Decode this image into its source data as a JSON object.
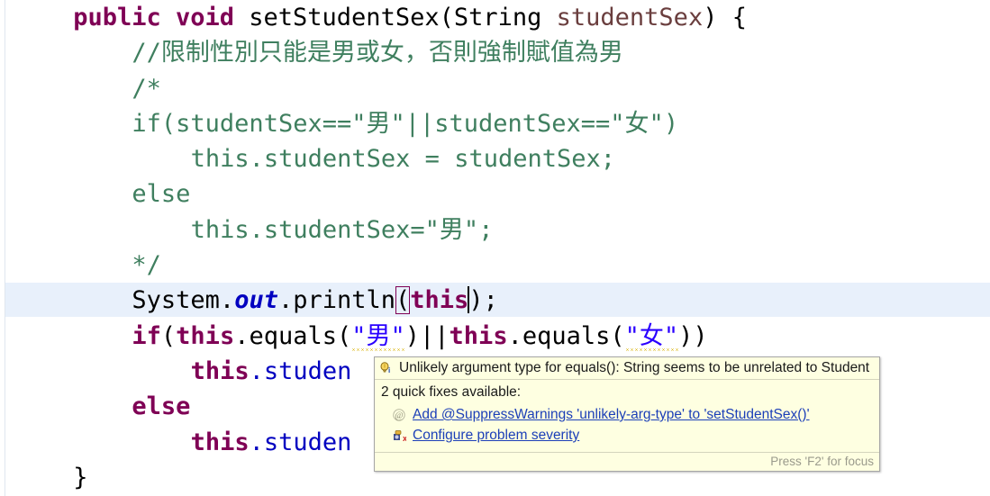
{
  "editor": {
    "language": "java",
    "current_line_index": 6,
    "colors": {
      "keyword": "#7f0055",
      "comment": "#3f7f5f",
      "string": "#2a00ff",
      "field": "#0000c0",
      "parameter": "#6a3e3e",
      "plain": "#000000",
      "line_highlight": "#e8f0fb",
      "bracket_match_outline": "#7f0055",
      "warning_squiggle": "#d8b000"
    },
    "lines": [
      {
        "indent": 4,
        "tokens": [
          {
            "text": "public void ",
            "style": "kw"
          },
          {
            "text": "setStudentSex(String ",
            "style": "plain"
          },
          {
            "text": "studentSex",
            "style": "param"
          },
          {
            "text": ") {",
            "style": "plain"
          }
        ]
      },
      {
        "indent": 8,
        "tokens": [
          {
            "text": "//限制性別只能是男或女，否則強制賦值為男",
            "style": "cmt"
          }
        ]
      },
      {
        "indent": 8,
        "tokens": [
          {
            "text": "/*",
            "style": "cmt"
          }
        ]
      },
      {
        "indent": 8,
        "tokens": [
          {
            "text": "if(studentSex==\"男\"||studentSex==\"女\")",
            "style": "cmt"
          }
        ]
      },
      {
        "indent": 12,
        "tokens": [
          {
            "text": "this.studentSex = studentSex;",
            "style": "cmt"
          }
        ]
      },
      {
        "indent": 8,
        "tokens": [
          {
            "text": "else",
            "style": "cmt"
          }
        ]
      },
      {
        "indent": 12,
        "tokens": [
          {
            "text": "this.studentSex=\"男\";",
            "style": "cmt"
          }
        ]
      },
      {
        "indent": 8,
        "tokens": [
          {
            "text": "*/",
            "style": "cmt"
          }
        ]
      },
      {
        "indent": 8,
        "highlighted": true,
        "tokens": [
          {
            "text": "System.",
            "style": "plain"
          },
          {
            "text": "out",
            "style": "statfld"
          },
          {
            "text": ".println",
            "style": "plain"
          },
          {
            "text": "(",
            "style": "plain",
            "bracket_match": true
          },
          {
            "text": "this",
            "style": "kw"
          },
          {
            "text": "",
            "style": "caret"
          },
          {
            "text": ");",
            "style": "plain"
          }
        ]
      },
      {
        "indent": 8,
        "tokens": [
          {
            "text": "if",
            "style": "kw"
          },
          {
            "text": "(",
            "style": "plain"
          },
          {
            "text": "this",
            "style": "kw"
          },
          {
            "text": ".equals(",
            "style": "plain"
          },
          {
            "text": "\"男\"",
            "style": "str",
            "squiggle": true
          },
          {
            "text": ")||",
            "style": "plain"
          },
          {
            "text": "this",
            "style": "kw"
          },
          {
            "text": ".equals(",
            "style": "plain"
          },
          {
            "text": "\"女\"",
            "style": "str",
            "squiggle": true
          },
          {
            "text": "))",
            "style": "plain"
          }
        ]
      },
      {
        "indent": 12,
        "tokens": [
          {
            "text": "this",
            "style": "kw"
          },
          {
            "text": ".studen",
            "style": "field"
          }
        ]
      },
      {
        "indent": 8,
        "tokens": [
          {
            "text": "else",
            "style": "kw"
          }
        ]
      },
      {
        "indent": 12,
        "tokens": [
          {
            "text": "this",
            "style": "kw"
          },
          {
            "text": ".studen",
            "style": "field"
          }
        ]
      },
      {
        "indent": 4,
        "tokens": [
          {
            "text": "}",
            "style": "plain"
          }
        ]
      }
    ]
  },
  "tooltip": {
    "header_icon": "lightbulb-info-icon",
    "header_text": "Unlikely argument type for equals(): String seems to be unrelated to Student",
    "count_text": "2 quick fixes available:",
    "fixes": [
      {
        "icon": "at-annotation-icon",
        "label": "Add @SuppressWarnings 'unlikely-arg-type' to 'setStudentSex()'"
      },
      {
        "icon": "configure-severity-icon",
        "label": "Configure problem severity"
      }
    ],
    "footer_text": "Press 'F2' for focus"
  }
}
